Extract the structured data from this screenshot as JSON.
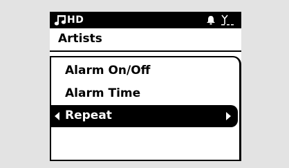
{
  "status_bar": {
    "source_label": "HD",
    "icons": [
      "music-note-icon",
      "alarm-bell-icon",
      "signal-antenna-icon"
    ]
  },
  "header": {
    "title": "Artists"
  },
  "menu": {
    "items": [
      {
        "label": "Alarm On/Off",
        "selected": false
      },
      {
        "label": "Alarm Time",
        "selected": false
      },
      {
        "label": "Repeat",
        "selected": true
      }
    ]
  },
  "colors": {
    "background": "#e3e3e3",
    "screen": "#ffffff",
    "text": "#000000",
    "highlight": "#000000",
    "highlight_text": "#ffffff"
  }
}
